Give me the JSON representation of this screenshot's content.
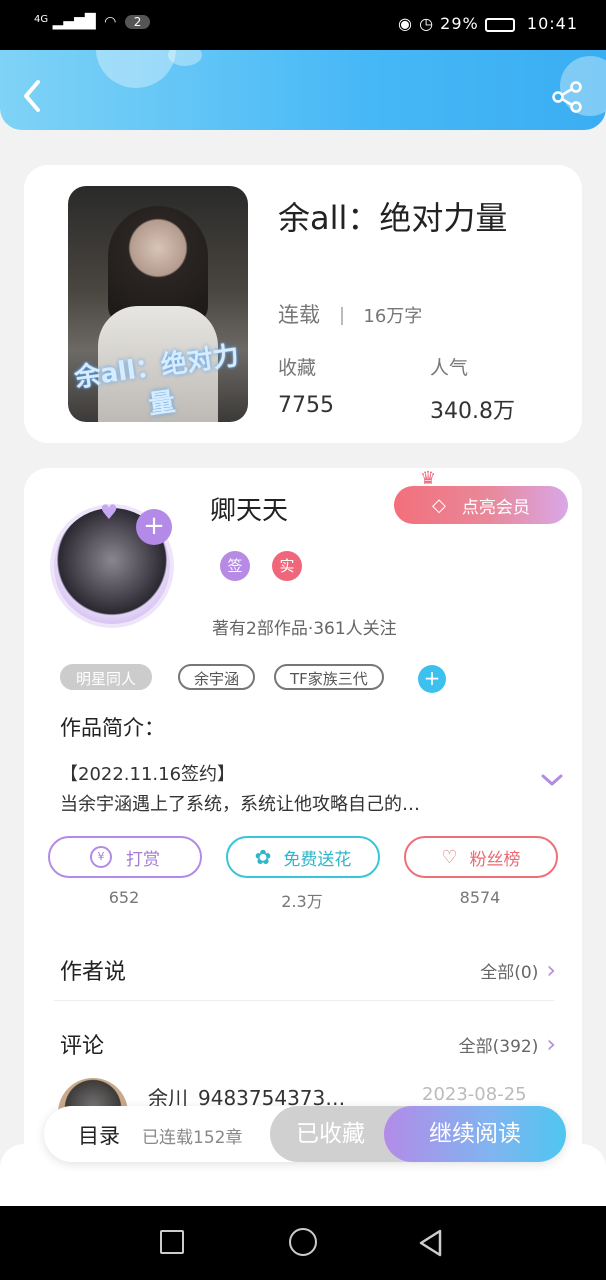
{
  "status_bar": {
    "network": "4G",
    "sim_badge": "2",
    "battery": "29%",
    "time": "10:41"
  },
  "header": {
    "back_icon": "chevron-left-icon",
    "share_icon": "share-icon"
  },
  "book": {
    "title": "余all：绝对力量",
    "cover_text": "余all：绝对力量",
    "status": "连载",
    "word_count": "16万字",
    "favorites_label": "收藏",
    "favorites_value": "7755",
    "popularity_label": "人气",
    "popularity_value": "340.8万"
  },
  "author": {
    "name": "卿天天",
    "vip_button": "点亮会员",
    "badge_signed": "签",
    "badge_verified": "实",
    "stats": "著有2部作品·361人关注"
  },
  "tags": [
    "明星同人",
    "余宇涵",
    "TF家族三代"
  ],
  "intro": {
    "heading": "作品简介：",
    "line1": "【2022.11.16签约】",
    "line2": "当余宇涵遇上了系统，系统让他攻略自己的…"
  },
  "actions": [
    {
      "label": "打赏",
      "count": "652"
    },
    {
      "label": "免费送花",
      "count": "2.3万"
    },
    {
      "label": "粉丝榜",
      "count": "8574"
    }
  ],
  "author_says": {
    "heading": "作者说",
    "link": "全部(0)"
  },
  "comments": {
    "heading": "评论",
    "link": "全部(392)",
    "first_user": "余川_9483754373…",
    "first_date": "2023-08-25"
  },
  "bottom_bar": {
    "catalog_label": "目录",
    "chapters": "已连载152章",
    "collected_button": "已收藏",
    "continue_button": "继续阅读"
  },
  "colors": {
    "header": "#47b8f6",
    "vip": "#f0667c",
    "purple": "#b28be6",
    "cyan": "#38c5d8",
    "pink": "#ef6f78"
  }
}
